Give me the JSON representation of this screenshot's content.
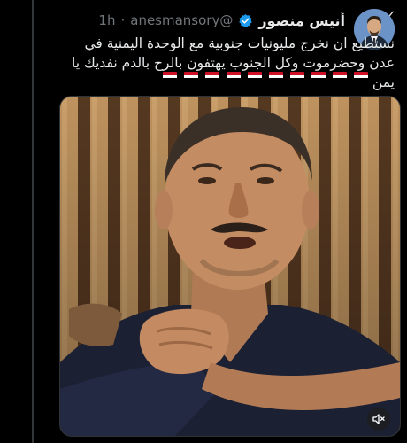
{
  "tweet": {
    "display_name": "أنيس منصور",
    "handle": "@anesmansory",
    "separator": "·",
    "time": "1h",
    "text": "نستطيع ان نخرج مليونيات جنوبية مع الوحدة اليمنية في عدن وحضرموت وكل الجنوب يهتفون بالرح بالدم نفديك يا يمن",
    "flag_count": 10
  },
  "icons": {
    "logo": "x-logo-icon",
    "verified": "verified-badge-icon",
    "mute": "speaker-muted-icon"
  },
  "colors": {
    "background": "#000000",
    "text": "#e7e9ea",
    "secondary_text": "#71767b",
    "verified": "#1d9bf0",
    "thread_line": "#333639"
  }
}
